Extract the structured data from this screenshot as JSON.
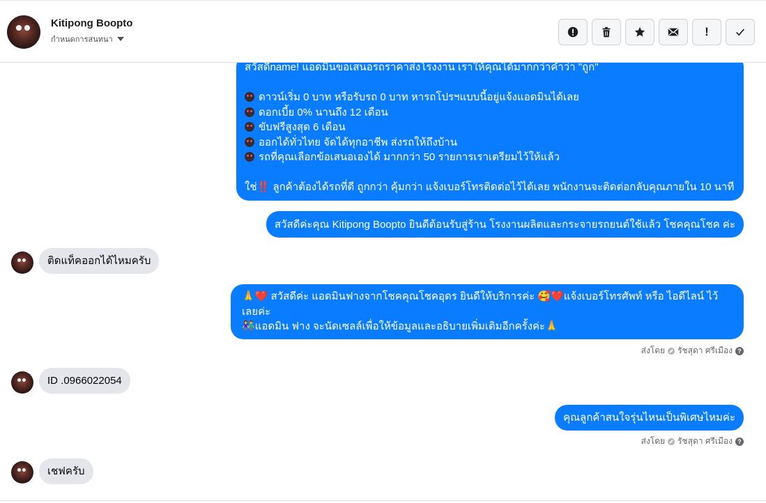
{
  "header": {
    "name": "Kitipong Boopto",
    "assign_label": "กำหนดการสนทนา",
    "actions": [
      {
        "icon": "alert-circle-icon",
        "glyph": ""
      },
      {
        "icon": "trash-icon",
        "glyph": ""
      },
      {
        "icon": "star-icon",
        "glyph": ""
      },
      {
        "icon": "mail-icon",
        "glyph": ""
      },
      {
        "icon": "exclamation-icon",
        "glyph": "!"
      },
      {
        "icon": "check-icon",
        "glyph": ""
      }
    ]
  },
  "messages": {
    "m1": {
      "l1": "สวัสดีname! แอดมินขอเสนอรถราคาส่งโรงงาน เราให้คุณได้มากกว่าคำว่า \"ถูก\"",
      "l2": "ดาวน์เริ่ม 0 บาท หรือรับรถ 0 บาท หารถโปรฯแบบนี้อยู่แจ้งแอดมินได้เลย",
      "l3": "ดอกเบี้ย 0% นานถึง 12 เดือน",
      "l4": "ขับฟรีสูงสุด 6 เดือน",
      "l5": "ออกได้ทั่วไทย จัดได้ทุกอาชีพ ส่งรถให้ถึงบ้าน",
      "l6": "รถที่คุณเลือกข้อเสนอเองได้ มากกว่า 50 รายการเราเตรียมไว้ให้แล้ว",
      "l7a": "ใช่",
      "l7b": "‼️",
      "l7c": " ลูกค้าต้องได้รถที่ดี ถูกกว่า คุ้มกว่า แจ้งเบอร์โทรติดต่อไว้ได้เลย พนักงานจะติดต่อกลับคุณภายใน 10 นาที"
    },
    "m2": "สวัสดีค่ะคุณ Kitipong Boopto ยินดีต้อนรับสู่ร้าน โรงงานผลิตและกระจายรถยนต์ใช้แล้ว โชคคุณโชค ค่ะ",
    "m3": "ติดแท็คออกได้ไหมครับ",
    "m4": {
      "l1": "🙏❤️ สวัสดีค่ะ แอดมินฟางจากโชคคุณโชคอุดร ยินดีให้บริการค่ะ 🥰❤️แจ้งเบอร์โทรศัพท์ หรือ ไอดีไลน์  ไว้",
      "l2": "เลยค่ะ",
      "l3": "👫แอดมิน ฟาง จะนัดเซลล์เพื่อให้ข้อมูลและอธิบายเพิ่มเติมอีกครั้งค่ะ🙏"
    },
    "m5": "ID .0966022054",
    "m6": "คุณลูกค้าสนใจรุ่นไหนเป็นพิเศษไหมค่ะ",
    "m7": "เชฟครับ"
  },
  "sent_by": {
    "prefix": "ส่งโดย",
    "agent": "รัชสุดา ศรีเมือง",
    "help": "?"
  }
}
